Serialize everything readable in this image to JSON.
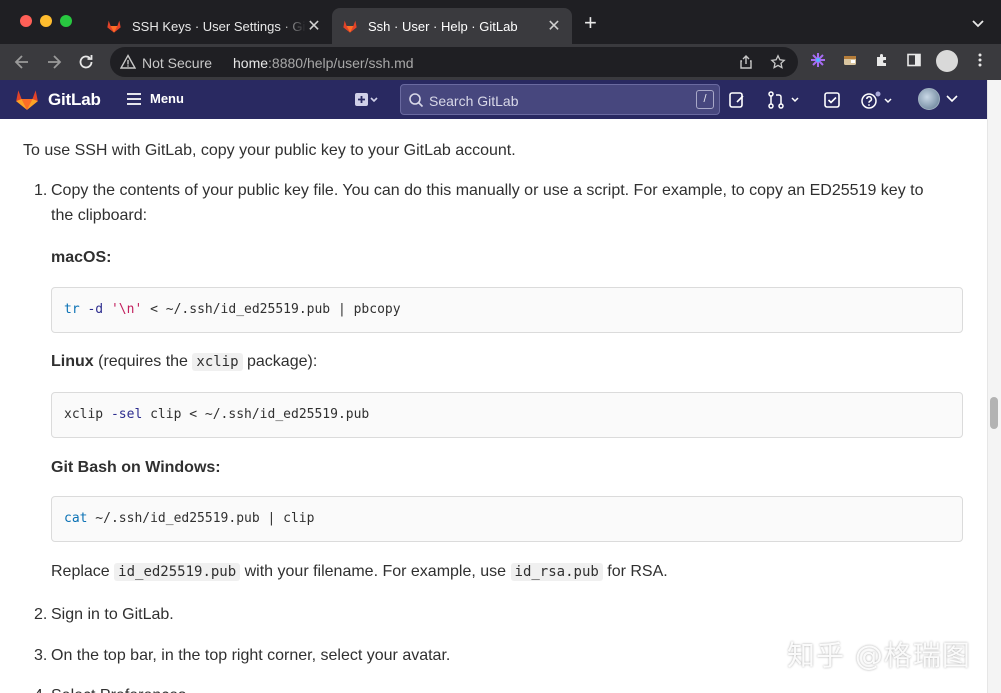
{
  "browser": {
    "tabs": [
      {
        "title": "SSH Keys · User Settings · GitLab",
        "close": "✕"
      },
      {
        "title": "Ssh · User · Help · GitLab",
        "close": "✕"
      }
    ],
    "new_tab": "+",
    "security_label": "Not Secure",
    "url_host": "home",
    "url_rest": ":8880/help/user/ssh.md"
  },
  "gitlab": {
    "brand": "GitLab",
    "menu_label": "Menu",
    "search_placeholder": "Search GitLab",
    "search_shortcut": "/",
    "header_color": "#292961"
  },
  "doc": {
    "intro": "To use SSH with GitLab, copy your public key to your GitLab account.",
    "steps": [
      {
        "number": "1.",
        "line1": "Copy the contents of your public key file. You can do this manually or use a script. For example, to copy an ED25519 key to",
        "line2": "the clipboard:"
      },
      {
        "number": "2.",
        "text": "Sign in to GitLab."
      },
      {
        "number": "3.",
        "text": "On the top bar, in the top right corner, select your avatar."
      },
      {
        "number": "4.",
        "text": "Select Preferences."
      }
    ],
    "macos_heading": "macOS:",
    "macos_code": {
      "cmd": "tr",
      "flag": "-d",
      "str": "'\\n'",
      "rest": " < ~/.ssh/id_ed25519.pub | pbcopy"
    },
    "linux_heading": "Linux",
    "linux_note_pre": " (requires the ",
    "linux_note_code": "xclip",
    "linux_note_post": " package):",
    "linux_code": {
      "cmd": "xclip ",
      "flag": "-sel",
      "rest": " clip < ~/.ssh/id_ed25519.pub"
    },
    "windows_heading": "Git Bash on Windows:",
    "windows_code": {
      "cmd": "cat",
      "rest": " ~/.ssh/id_ed25519.pub | clip"
    },
    "replace_pre": "Replace ",
    "replace_code1": "id_ed25519.pub",
    "replace_mid": " with your filename. For example, use ",
    "replace_code2": "id_rsa.pub",
    "replace_post": " for RSA."
  },
  "watermark": "知乎 @格瑞图"
}
